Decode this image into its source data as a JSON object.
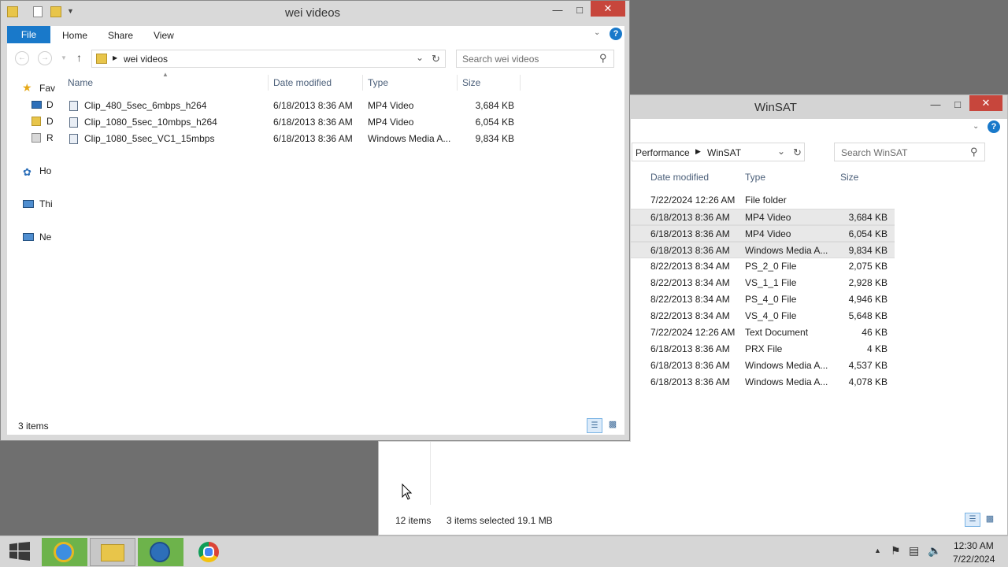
{
  "back_window": {
    "title": "WinSAT",
    "breadcrumb": [
      "Performance",
      "WinSAT"
    ],
    "search_placeholder": "Search WinSAT",
    "columns": [
      "Date modified",
      "Type",
      "Size"
    ],
    "rows": [
      {
        "date": "7/22/2024 12:26 AM",
        "type": "File folder",
        "size": "",
        "selected": false
      },
      {
        "date": "6/18/2013 8:36 AM",
        "type": "MP4 Video",
        "size": "3,684 KB",
        "selected": true
      },
      {
        "date": "6/18/2013 8:36 AM",
        "type": "MP4 Video",
        "size": "6,054 KB",
        "selected": true
      },
      {
        "date": "6/18/2013 8:36 AM",
        "type": "Windows Media A...",
        "size": "9,834 KB",
        "selected": true
      },
      {
        "date": "8/22/2013 8:34 AM",
        "type": "PS_2_0 File",
        "size": "2,075 KB",
        "selected": false
      },
      {
        "date": "8/22/2013 8:34 AM",
        "type": "VS_1_1 File",
        "size": "2,928 KB",
        "selected": false
      },
      {
        "date": "8/22/2013 8:34 AM",
        "type": "PS_4_0 File",
        "size": "4,946 KB",
        "selected": false
      },
      {
        "date": "8/22/2013 8:34 AM",
        "type": "VS_4_0 File",
        "size": "5,648 KB",
        "selected": false
      },
      {
        "date": "7/22/2024 12:26 AM",
        "type": "Text Document",
        "size": "46 KB",
        "selected": false
      },
      {
        "date": "6/18/2013 8:36 AM",
        "type": "PRX File",
        "size": "4 KB",
        "selected": false
      },
      {
        "date": "6/18/2013 8:36 AM",
        "type": "Windows Media A...",
        "size": "4,537 KB",
        "selected": false
      },
      {
        "date": "6/18/2013 8:36 AM",
        "type": "Windows Media A...",
        "size": "4,078 KB",
        "selected": false
      }
    ],
    "status": {
      "items": "12 items",
      "selected": "3 items selected",
      "size": "19.1 MB"
    }
  },
  "front_window": {
    "title": "wei videos",
    "ribbon_tabs": [
      "File",
      "Home",
      "Share",
      "View"
    ],
    "path": "wei videos",
    "search_placeholder": "Search wei videos",
    "columns": [
      "Name",
      "Date modified",
      "Type",
      "Size"
    ],
    "nav": [
      "Fav",
      "D",
      "D",
      "R",
      "Ho",
      "Thi",
      "Ne"
    ],
    "files": [
      {
        "name": "Clip_480_5sec_6mbps_h264",
        "date": "6/18/2013 8:36 AM",
        "type": "MP4 Video",
        "size": "3,684 KB"
      },
      {
        "name": "Clip_1080_5sec_10mbps_h264",
        "date": "6/18/2013 8:36 AM",
        "type": "MP4 Video",
        "size": "6,054 KB"
      },
      {
        "name": "Clip_1080_5sec_VC1_15mbps",
        "date": "6/18/2013 8:36 AM",
        "type": "Windows Media A...",
        "size": "9,834 KB"
      }
    ],
    "status": "3 items"
  },
  "taskbar": {
    "time": "12:30 AM",
    "date": "7/22/2024"
  },
  "icons": [
    "start-icon",
    "ie-icon",
    "explorer-icon",
    "network-app-icon",
    "chrome-icon",
    "flag-icon",
    "network-icon",
    "volume-icon",
    "search-icon",
    "refresh-icon",
    "help-icon"
  ],
  "colors": {
    "file_tab": "#1979ca",
    "close": "#c7463c",
    "taskbar": "#d6d6d6"
  }
}
